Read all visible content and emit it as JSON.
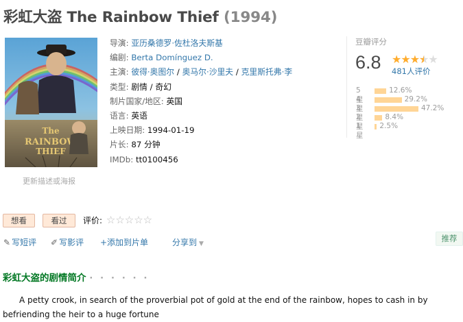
{
  "movie": {
    "title": "彩虹大盗 The Rainbow Thief",
    "year": "(1994)",
    "poster_link": "更新描述或海报"
  },
  "info": {
    "director_label": "导演:",
    "director": "亚历桑德罗·佐杜洛夫斯基",
    "writer_label": "编剧:",
    "writer": "Berta Domínguez D.",
    "cast_label": "主演:",
    "cast": [
      "彼得·奥图尔",
      "奥马尔·沙里夫",
      "克里斯托弗·李"
    ],
    "cast_sep": " / ",
    "genre_label": "类型:",
    "genre": "剧情 / 奇幻",
    "country_label": "制片国家/地区:",
    "country": "英国",
    "language_label": "语言:",
    "language": "英语",
    "release_label": "上映日期:",
    "release": "1994-01-19",
    "runtime_label": "片长:",
    "runtime": "87 分钟",
    "imdb_label": "IMDb:",
    "imdb": "tt0100456"
  },
  "rating": {
    "title": "豆瓣评分",
    "score": "6.8",
    "stars_out_of_5": 3.5,
    "votes": "481人评价",
    "distribution": [
      {
        "label": "5星",
        "percent": "12.6%",
        "value": 12.6
      },
      {
        "label": "4星",
        "percent": "29.2%",
        "value": 29.2
      },
      {
        "label": "3星",
        "percent": "47.2%",
        "value": 47.2
      },
      {
        "label": "2星",
        "percent": "8.4%",
        "value": 8.4
      },
      {
        "label": "1星",
        "percent": "2.5%",
        "value": 2.5
      }
    ],
    "bar_color": "#ffd596",
    "star_color": "#ffac2d"
  },
  "actions": {
    "want": "想看",
    "seen": "看过",
    "my_rating_label": "评价:",
    "short_review": "写短评",
    "review": "写影评",
    "add_list": "+添加到片单",
    "share": "分享到",
    "recommend": "推荐"
  },
  "synopsis": {
    "title": "彩虹大盗的剧情简介",
    "dots": "· · · · · ·",
    "text": "A petty crook, in search of the proverbial pot of gold at the end of the rainbow, hopes to cash in by befriending the heir to a huge fortune"
  }
}
